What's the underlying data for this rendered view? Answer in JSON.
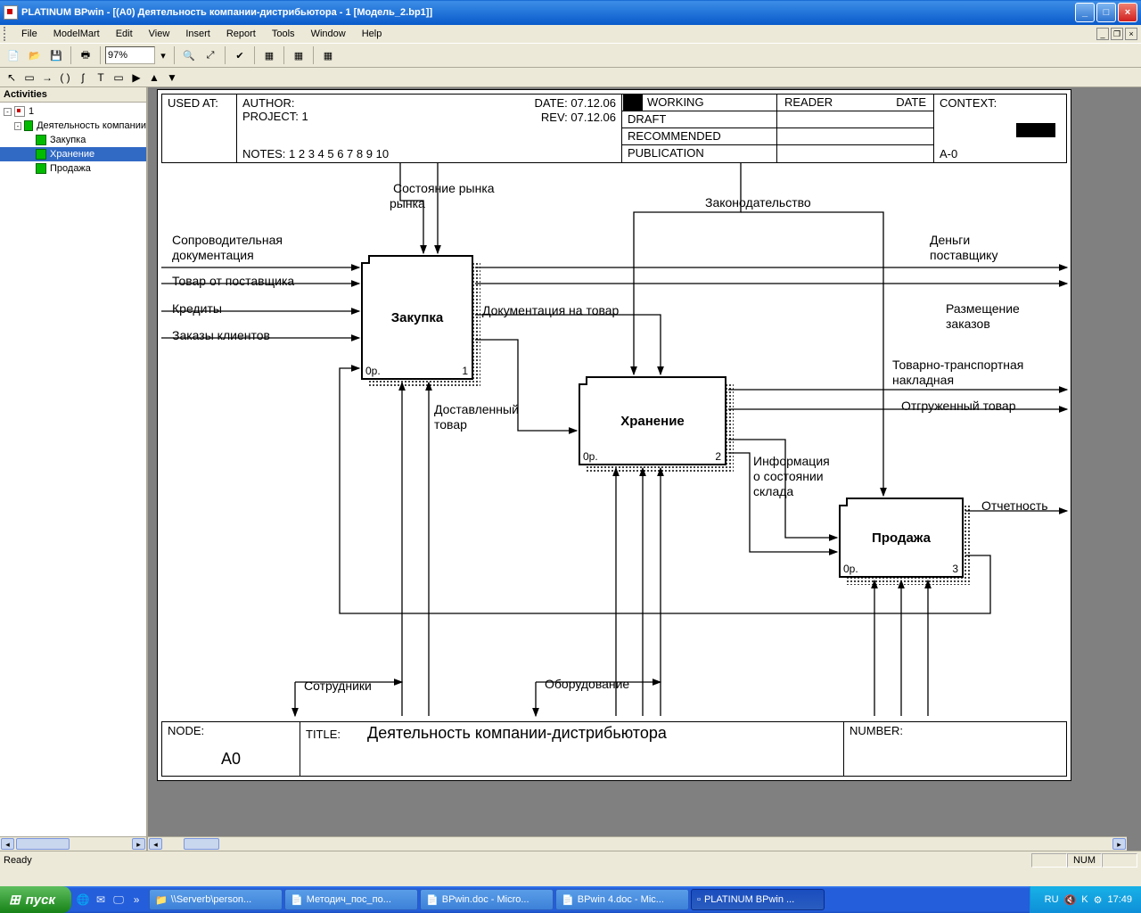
{
  "title": "PLATINUM BPwin - [(A0) Деятельность  компании-дистрибьютора - 1  [Модель_2.bp1]]",
  "menus": [
    "File",
    "ModelMart",
    "Edit",
    "View",
    "Insert",
    "Report",
    "Tools",
    "Window",
    "Help"
  ],
  "zoom": "97%",
  "side": {
    "title": "Activities",
    "nodes": [
      {
        "label": "1",
        "lvl": 0,
        "icon": "root",
        "exp": "-"
      },
      {
        "label": "Деятельность компании",
        "lvl": 1,
        "icon": "green",
        "exp": "-"
      },
      {
        "label": "Закупка",
        "lvl": 2,
        "icon": "green",
        "exp": ""
      },
      {
        "label": "Хранение",
        "lvl": 2,
        "icon": "green",
        "exp": "",
        "sel": true
      },
      {
        "label": "Продажа",
        "lvl": 2,
        "icon": "green",
        "exp": ""
      }
    ]
  },
  "header": {
    "used_at": "USED AT:",
    "author": "AUTHOR:",
    "project": "PROJECT:  1",
    "notes": "NOTES:  1  2  3  4  5  6  7  8  9  10",
    "date": "DATE: 07.12.06",
    "rev": "REV:   07.12.06",
    "s1": "WORKING",
    "s2": "DRAFT",
    "s3": "RECOMMENDED",
    "s4": "PUBLICATION",
    "reader": "READER",
    "rdate": "DATE",
    "context": "CONTEXT:",
    "ctxval": "A-0"
  },
  "footer": {
    "node": "NODE:",
    "nodeval": "A0",
    "title": "TITLE:",
    "titleval": "Деятельность  компании-дистрибьютора",
    "number": "NUMBER:"
  },
  "boxes": {
    "b1": {
      "name": "Закупка",
      "bl": "0р.",
      "br": "1"
    },
    "b2": {
      "name": "Хранение",
      "bl": "0р.",
      "br": "2"
    },
    "b3": {
      "name": "Продажа",
      "bl": "0р.",
      "br": "3"
    }
  },
  "labels": {
    "l1": "Состояние рынка",
    "l2": "Законодательство",
    "l3": "Сопроводительная документация",
    "l4": "Товар от поставщика",
    "l5": "Кредиты",
    "l6": "Заказы клиентов",
    "l7": "Деньги поставщику",
    "l8": "Размещение заказов",
    "l9": "Товарно-транспортная накладная",
    "l10": "Отгруженный товар",
    "l11": "Отчетность",
    "l12": "Документация на товар",
    "l13": "Доставленный товар",
    "l14": "Информация о состоянии склада",
    "l15": "Сотрудники",
    "l16": "Оборудование"
  },
  "status": {
    "ready": "Ready",
    "num": "NUM"
  },
  "taskbar": {
    "start": "пуск",
    "tasks": [
      "\\\\Serverb\\person...",
      "Методич_пос_по...",
      "BPwin.doc - Micro...",
      "BPwin 4.doc - Mic...",
      "PLATINUM BPwin ..."
    ],
    "lang": "RU",
    "time": "17:49"
  }
}
